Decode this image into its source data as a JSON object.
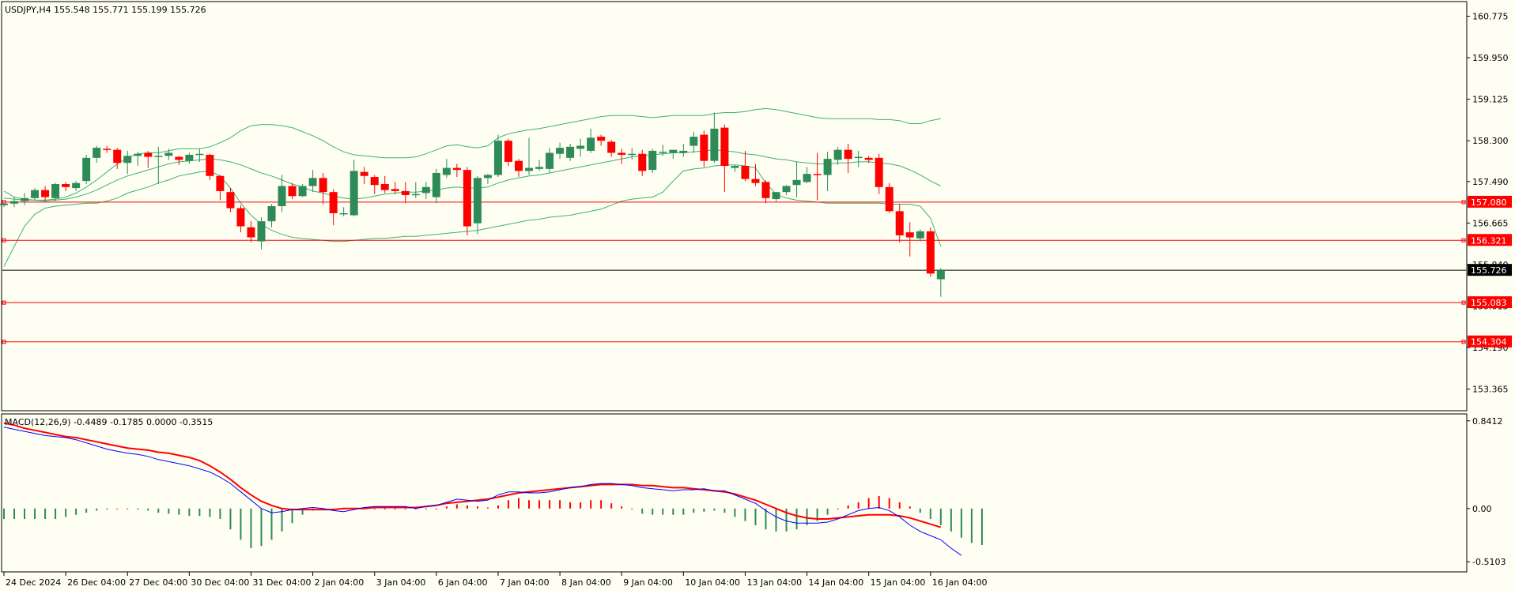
{
  "main_panel": {
    "header_text": "USDJPY,H4  155.548 155.771 155.199 155.726",
    "price_axis_labels": [
      {
        "price": 160.775,
        "text": "160.775"
      },
      {
        "price": 159.95,
        "text": "159.950"
      },
      {
        "price": 159.125,
        "text": "159.125"
      },
      {
        "price": 158.3,
        "text": "158.300"
      },
      {
        "price": 157.49,
        "text": "157.490"
      },
      {
        "price": 156.665,
        "text": "156.665"
      },
      {
        "price": 155.84,
        "text": "155.840"
      },
      {
        "price": 155.015,
        "text": "155.015"
      },
      {
        "price": 154.19,
        "text": "154.190"
      },
      {
        "price": 153.365,
        "text": "153.365"
      }
    ],
    "horizontal_lines": [
      {
        "price": 157.08,
        "label": "157.080",
        "color": "#ff0000"
      },
      {
        "price": 156.321,
        "label": "156.321",
        "color": "#ff0000"
      },
      {
        "price": 155.083,
        "label": "155.083",
        "color": "#ff0000"
      },
      {
        "price": 154.304,
        "label": "154.304",
        "color": "#ff0000"
      }
    ],
    "current_price": {
      "price": 155.726,
      "label": "155.726",
      "color": "#000000"
    }
  },
  "macd_panel": {
    "header_text": "MACD(12,26,9) -0.4489 -0.1785 0.0000 -0.3515",
    "axis_labels": [
      {
        "value": 0.8412,
        "text": "0.8412"
      },
      {
        "value": 0.0,
        "text": "0.00"
      },
      {
        "value": -0.5103,
        "text": "-0.5103"
      }
    ]
  },
  "time_axis_labels": [
    {
      "bar": 0,
      "text": "24 Dec 2024"
    },
    {
      "bar": 6,
      "text": "26 Dec 04:00"
    },
    {
      "bar": 12,
      "text": "27 Dec 04:00"
    },
    {
      "bar": 18,
      "text": "30 Dec 04:00"
    },
    {
      "bar": 24,
      "text": "31 Dec 04:00"
    },
    {
      "bar": 30,
      "text": "2 Jan 04:00"
    },
    {
      "bar": 36,
      "text": "3 Jan 04:00"
    },
    {
      "bar": 42,
      "text": "6 Jan 04:00"
    },
    {
      "bar": 48,
      "text": "7 Jan 04:00"
    },
    {
      "bar": 54,
      "text": "8 Jan 04:00"
    },
    {
      "bar": 60,
      "text": "9 Jan 04:00"
    },
    {
      "bar": 66,
      "text": "10 Jan 04:00"
    },
    {
      "bar": 72,
      "text": "13 Jan 04:00"
    },
    {
      "bar": 78,
      "text": "14 Jan 04:00"
    },
    {
      "bar": 84,
      "text": "15 Jan 04:00"
    },
    {
      "bar": 90,
      "text": "16 Jan 04:00"
    }
  ],
  "colors": {
    "background": "#fefef2",
    "bull_candle": "#2e8b57",
    "bear_candle": "#ff0000",
    "bands": "#3cb371",
    "macd_line": "#0000ff",
    "signal_line": "#ff0000"
  },
  "chart_data": {
    "type": "candlestick",
    "symbol": "USDJPY",
    "timeframe": "H4",
    "ylim": [
      152.95,
      161.05
    ],
    "candles": [
      [
        157.02,
        157.06,
        156.98,
        157.05
      ],
      [
        157.05,
        157.18,
        156.98,
        157.1
      ],
      [
        157.1,
        157.26,
        157.02,
        157.16
      ],
      [
        157.16,
        157.36,
        157.12,
        157.32
      ],
      [
        157.32,
        157.4,
        157.1,
        157.18
      ],
      [
        157.16,
        157.46,
        157.1,
        157.44
      ],
      [
        157.44,
        157.48,
        157.3,
        157.38
      ],
      [
        157.36,
        157.5,
        157.3,
        157.46
      ],
      [
        157.5,
        158.02,
        157.44,
        157.96
      ],
      [
        157.96,
        158.2,
        157.86,
        158.16
      ],
      [
        158.14,
        158.2,
        158.06,
        158.12
      ],
      [
        158.12,
        158.16,
        157.74,
        157.86
      ],
      [
        157.86,
        158.1,
        157.64,
        158.0
      ],
      [
        158.0,
        158.08,
        157.8,
        158.04
      ],
      [
        158.06,
        158.1,
        157.76,
        157.98
      ],
      [
        157.98,
        158.18,
        157.44,
        158.0
      ],
      [
        158.0,
        158.14,
        157.92,
        158.06
      ],
      [
        157.98,
        158.0,
        157.82,
        157.92
      ],
      [
        157.9,
        158.06,
        157.84,
        158.02
      ],
      [
        158.02,
        158.14,
        157.88,
        158.04
      ],
      [
        158.02,
        158.04,
        157.52,
        157.6
      ],
      [
        157.6,
        157.62,
        157.12,
        157.3
      ],
      [
        157.28,
        157.36,
        156.88,
        156.96
      ],
      [
        156.96,
        157.02,
        156.48,
        156.6
      ],
      [
        156.58,
        156.7,
        156.28,
        156.38
      ],
      [
        156.3,
        156.78,
        156.14,
        156.7
      ],
      [
        156.7,
        157.04,
        156.58,
        157.0
      ],
      [
        157.0,
        157.62,
        156.88,
        157.4
      ],
      [
        157.4,
        157.46,
        157.14,
        157.2
      ],
      [
        157.2,
        157.44,
        157.18,
        157.4
      ],
      [
        157.4,
        157.72,
        157.28,
        157.56
      ],
      [
        157.56,
        157.66,
        157.04,
        157.28
      ],
      [
        157.28,
        157.34,
        156.62,
        156.86
      ],
      [
        156.84,
        156.98,
        156.8,
        156.86
      ],
      [
        156.82,
        157.92,
        156.8,
        157.7
      ],
      [
        157.68,
        157.78,
        157.44,
        157.6
      ],
      [
        157.58,
        157.62,
        157.24,
        157.42
      ],
      [
        157.44,
        157.6,
        157.26,
        157.32
      ],
      [
        157.34,
        157.48,
        157.24,
        157.3
      ],
      [
        157.3,
        157.48,
        157.06,
        157.22
      ],
      [
        157.22,
        157.48,
        157.16,
        157.24
      ],
      [
        157.26,
        157.48,
        157.14,
        157.38
      ],
      [
        157.18,
        157.74,
        157.06,
        157.66
      ],
      [
        157.62,
        157.94,
        157.56,
        157.76
      ],
      [
        157.76,
        157.84,
        157.58,
        157.72
      ],
      [
        157.72,
        157.78,
        156.42,
        156.6
      ],
      [
        156.66,
        157.6,
        156.44,
        157.56
      ],
      [
        157.56,
        157.64,
        157.44,
        157.62
      ],
      [
        157.62,
        158.42,
        157.58,
        158.3
      ],
      [
        158.3,
        158.34,
        157.8,
        157.88
      ],
      [
        157.9,
        157.94,
        157.58,
        157.7
      ],
      [
        157.7,
        158.36,
        157.62,
        157.76
      ],
      [
        157.74,
        157.92,
        157.7,
        157.78
      ],
      [
        157.74,
        158.16,
        157.66,
        158.06
      ],
      [
        158.04,
        158.26,
        157.94,
        158.16
      ],
      [
        157.96,
        158.24,
        157.9,
        158.18
      ],
      [
        158.14,
        158.34,
        157.98,
        158.2
      ],
      [
        158.1,
        158.54,
        158.06,
        158.36
      ],
      [
        158.38,
        158.42,
        158.2,
        158.3
      ],
      [
        158.28,
        158.32,
        157.98,
        158.06
      ],
      [
        158.06,
        158.14,
        157.84,
        158.02
      ],
      [
        158.02,
        158.16,
        157.92,
        158.04
      ],
      [
        158.04,
        158.12,
        157.6,
        157.7
      ],
      [
        157.72,
        158.14,
        157.66,
        158.1
      ],
      [
        158.06,
        158.22,
        158.0,
        158.08
      ],
      [
        158.06,
        158.1,
        157.94,
        158.12
      ],
      [
        158.06,
        158.24,
        157.98,
        158.1
      ],
      [
        158.2,
        158.48,
        158.06,
        158.38
      ],
      [
        158.42,
        158.5,
        157.78,
        157.9
      ],
      [
        157.9,
        158.86,
        157.86,
        158.54
      ],
      [
        158.56,
        158.62,
        157.28,
        157.8
      ],
      [
        157.76,
        157.82,
        157.68,
        157.8
      ],
      [
        157.8,
        158.1,
        157.5,
        157.54
      ],
      [
        157.54,
        157.84,
        157.4,
        157.46
      ],
      [
        157.48,
        157.52,
        157.06,
        157.16
      ],
      [
        157.14,
        157.26,
        157.08,
        157.28
      ],
      [
        157.28,
        157.42,
        157.22,
        157.4
      ],
      [
        157.42,
        157.88,
        157.18,
        157.52
      ],
      [
        157.48,
        157.78,
        157.46,
        157.64
      ],
      [
        157.64,
        158.06,
        157.12,
        157.62
      ],
      [
        157.62,
        158.08,
        157.3,
        157.94
      ],
      [
        157.92,
        158.18,
        157.82,
        158.12
      ],
      [
        158.12,
        158.24,
        157.66,
        157.94
      ],
      [
        157.96,
        158.1,
        157.78,
        157.98
      ],
      [
        157.96,
        158.0,
        157.86,
        157.92
      ],
      [
        157.96,
        158.04,
        157.24,
        157.38
      ],
      [
        157.38,
        157.46,
        156.86,
        156.9
      ],
      [
        156.9,
        157.04,
        156.28,
        156.42
      ],
      [
        156.48,
        156.68,
        156.0,
        156.38
      ],
      [
        156.36,
        156.54,
        156.3,
        156.5
      ],
      [
        156.5,
        156.58,
        155.6,
        155.66
      ],
      [
        155.548,
        155.771,
        155.199,
        155.726
      ]
    ],
    "bollinger_bands": {
      "upper": [
        157.3,
        157.18,
        157.14,
        157.12,
        157.12,
        157.14,
        157.18,
        157.26,
        157.38,
        157.52,
        157.68,
        157.84,
        157.96,
        158.04,
        158.06,
        158.06,
        158.1,
        158.14,
        158.14,
        158.14,
        158.18,
        158.26,
        158.36,
        158.5,
        158.6,
        158.62,
        158.62,
        158.6,
        158.56,
        158.48,
        158.4,
        158.3,
        158.18,
        158.08,
        158.02,
        158.0,
        157.98,
        157.96,
        157.96,
        157.96,
        157.98,
        158.04,
        158.12,
        158.2,
        158.22,
        158.18,
        158.16,
        158.2,
        158.36,
        158.44,
        158.48,
        158.52,
        158.54,
        158.58,
        158.62,
        158.66,
        158.7,
        158.74,
        158.78,
        158.8,
        158.8,
        158.8,
        158.78,
        158.76,
        158.78,
        158.8,
        158.8,
        158.8,
        158.8,
        158.84,
        158.86,
        158.86,
        158.88,
        158.92,
        158.94,
        158.92,
        158.88,
        158.84,
        158.8,
        158.76,
        158.74,
        158.74,
        158.74,
        158.74,
        158.74,
        158.72,
        158.72,
        158.7,
        158.64,
        158.64,
        158.7,
        158.74
      ],
      "middle": [
        157.16,
        157.14,
        157.12,
        157.12,
        157.1,
        157.12,
        157.14,
        157.18,
        157.24,
        157.32,
        157.42,
        157.52,
        157.6,
        157.66,
        157.72,
        157.78,
        157.84,
        157.88,
        157.9,
        157.92,
        157.94,
        157.92,
        157.88,
        157.82,
        157.74,
        157.66,
        157.6,
        157.52,
        157.44,
        157.38,
        157.3,
        157.26,
        157.2,
        157.16,
        157.14,
        157.16,
        157.2,
        157.24,
        157.26,
        157.28,
        157.28,
        157.3,
        157.32,
        157.36,
        157.38,
        157.36,
        157.36,
        157.38,
        157.46,
        157.52,
        157.56,
        157.6,
        157.62,
        157.66,
        157.7,
        157.74,
        157.78,
        157.82,
        157.86,
        157.9,
        157.94,
        157.98,
        158.0,
        158.02,
        158.04,
        158.06,
        158.06,
        158.08,
        158.1,
        158.12,
        158.1,
        158.08,
        158.04,
        158.02,
        157.98,
        157.94,
        157.92,
        157.88,
        157.86,
        157.84,
        157.84,
        157.86,
        157.86,
        157.88,
        157.88,
        157.86,
        157.84,
        157.8,
        157.72,
        157.62,
        157.5,
        157.4
      ],
      "lower": [
        155.8,
        156.2,
        156.6,
        156.84,
        156.96,
        157.0,
        157.02,
        157.04,
        157.06,
        157.06,
        157.1,
        157.16,
        157.26,
        157.32,
        157.38,
        157.46,
        157.52,
        157.6,
        157.64,
        157.68,
        157.7,
        157.6,
        157.36,
        157.06,
        156.82,
        156.64,
        156.52,
        156.44,
        156.38,
        156.36,
        156.34,
        156.32,
        156.3,
        156.3,
        156.32,
        156.34,
        156.36,
        156.36,
        156.38,
        156.4,
        156.4,
        156.42,
        156.44,
        156.46,
        156.48,
        156.5,
        156.52,
        156.56,
        156.6,
        156.64,
        156.68,
        156.72,
        156.74,
        156.78,
        156.8,
        156.82,
        156.86,
        156.9,
        156.94,
        157.02,
        157.1,
        157.14,
        157.16,
        157.18,
        157.28,
        157.5,
        157.7,
        157.74,
        157.76,
        157.8,
        157.82,
        157.82,
        157.8,
        157.76,
        157.46,
        157.24,
        157.16,
        157.12,
        157.1,
        157.08,
        157.06,
        157.06,
        157.06,
        157.06,
        157.06,
        157.06,
        157.04,
        157.04,
        157.04,
        157.0,
        156.76,
        156.2
      ]
    },
    "macd": {
      "ylim": [
        -0.6,
        0.9
      ],
      "histogram": [
        -0.1,
        -0.1,
        -0.1,
        -0.1,
        -0.1,
        -0.1,
        -0.08,
        -0.06,
        -0.04,
        -0.02,
        -0.01,
        0.0,
        0.0,
        -0.01,
        -0.02,
        -0.04,
        -0.05,
        -0.06,
        -0.07,
        -0.07,
        -0.08,
        -0.1,
        -0.2,
        -0.3,
        -0.38,
        -0.36,
        -0.3,
        -0.22,
        -0.14,
        -0.06,
        -0.02,
        -0.01,
        0.0,
        0.0,
        0.0,
        0.0,
        0.0,
        0.0,
        0.0,
        0.0,
        0.0,
        0.0,
        0.0,
        0.02,
        0.04,
        0.03,
        0.02,
        0.01,
        0.03,
        0.08,
        0.1,
        0.08,
        0.08,
        0.08,
        0.08,
        0.06,
        0.06,
        0.08,
        0.08,
        0.05,
        0.02,
        0.0,
        -0.05,
        -0.06,
        -0.06,
        -0.06,
        -0.06,
        -0.04,
        -0.03,
        -0.02,
        -0.04,
        -0.08,
        -0.12,
        -0.16,
        -0.2,
        -0.22,
        -0.22,
        -0.2,
        -0.16,
        -0.12,
        -0.06,
        0.0,
        0.03,
        0.06,
        0.1,
        0.12,
        0.1,
        0.06,
        0.02,
        -0.04,
        -0.1,
        -0.16,
        -0.22,
        -0.28,
        -0.33,
        -0.35
      ],
      "macd_line": [
        0.78,
        0.76,
        0.74,
        0.72,
        0.7,
        0.69,
        0.68,
        0.66,
        0.63,
        0.6,
        0.57,
        0.55,
        0.53,
        0.52,
        0.5,
        0.47,
        0.45,
        0.43,
        0.41,
        0.38,
        0.35,
        0.3,
        0.24,
        0.16,
        0.08,
        0.0,
        -0.04,
        -0.03,
        -0.01,
        0.0,
        0.01,
        0.0,
        -0.02,
        -0.03,
        -0.01,
        0.01,
        0.02,
        0.02,
        0.02,
        0.02,
        0.0,
        0.02,
        0.03,
        0.06,
        0.09,
        0.08,
        0.07,
        0.08,
        0.13,
        0.16,
        0.16,
        0.15,
        0.15,
        0.16,
        0.18,
        0.2,
        0.21,
        0.23,
        0.24,
        0.24,
        0.23,
        0.22,
        0.2,
        0.19,
        0.18,
        0.17,
        0.18,
        0.18,
        0.19,
        0.17,
        0.17,
        0.13,
        0.09,
        0.05,
        -0.02,
        -0.08,
        -0.12,
        -0.14,
        -0.14,
        -0.14,
        -0.13,
        -0.1,
        -0.06,
        -0.02,
        0.0,
        0.01,
        -0.02,
        -0.08,
        -0.16,
        -0.22,
        -0.26,
        -0.3,
        -0.38,
        -0.45
      ],
      "signal_line": [
        0.82,
        0.8,
        0.77,
        0.75,
        0.73,
        0.71,
        0.69,
        0.68,
        0.66,
        0.64,
        0.62,
        0.6,
        0.58,
        0.57,
        0.56,
        0.54,
        0.53,
        0.51,
        0.49,
        0.46,
        0.41,
        0.35,
        0.28,
        0.2,
        0.13,
        0.07,
        0.03,
        0.0,
        -0.01,
        -0.01,
        -0.01,
        -0.01,
        -0.01,
        0.0,
        0.0,
        0.0,
        0.01,
        0.01,
        0.01,
        0.01,
        0.01,
        0.02,
        0.03,
        0.05,
        0.06,
        0.07,
        0.08,
        0.09,
        0.11,
        0.13,
        0.15,
        0.16,
        0.17,
        0.18,
        0.19,
        0.2,
        0.21,
        0.22,
        0.23,
        0.23,
        0.23,
        0.23,
        0.22,
        0.22,
        0.21,
        0.2,
        0.2,
        0.19,
        0.18,
        0.17,
        0.16,
        0.14,
        0.11,
        0.08,
        0.04,
        0.0,
        -0.04,
        -0.07,
        -0.09,
        -0.1,
        -0.1,
        -0.09,
        -0.08,
        -0.07,
        -0.06,
        -0.06,
        -0.06,
        -0.07,
        -0.09,
        -0.12,
        -0.15,
        -0.18
      ]
    }
  }
}
